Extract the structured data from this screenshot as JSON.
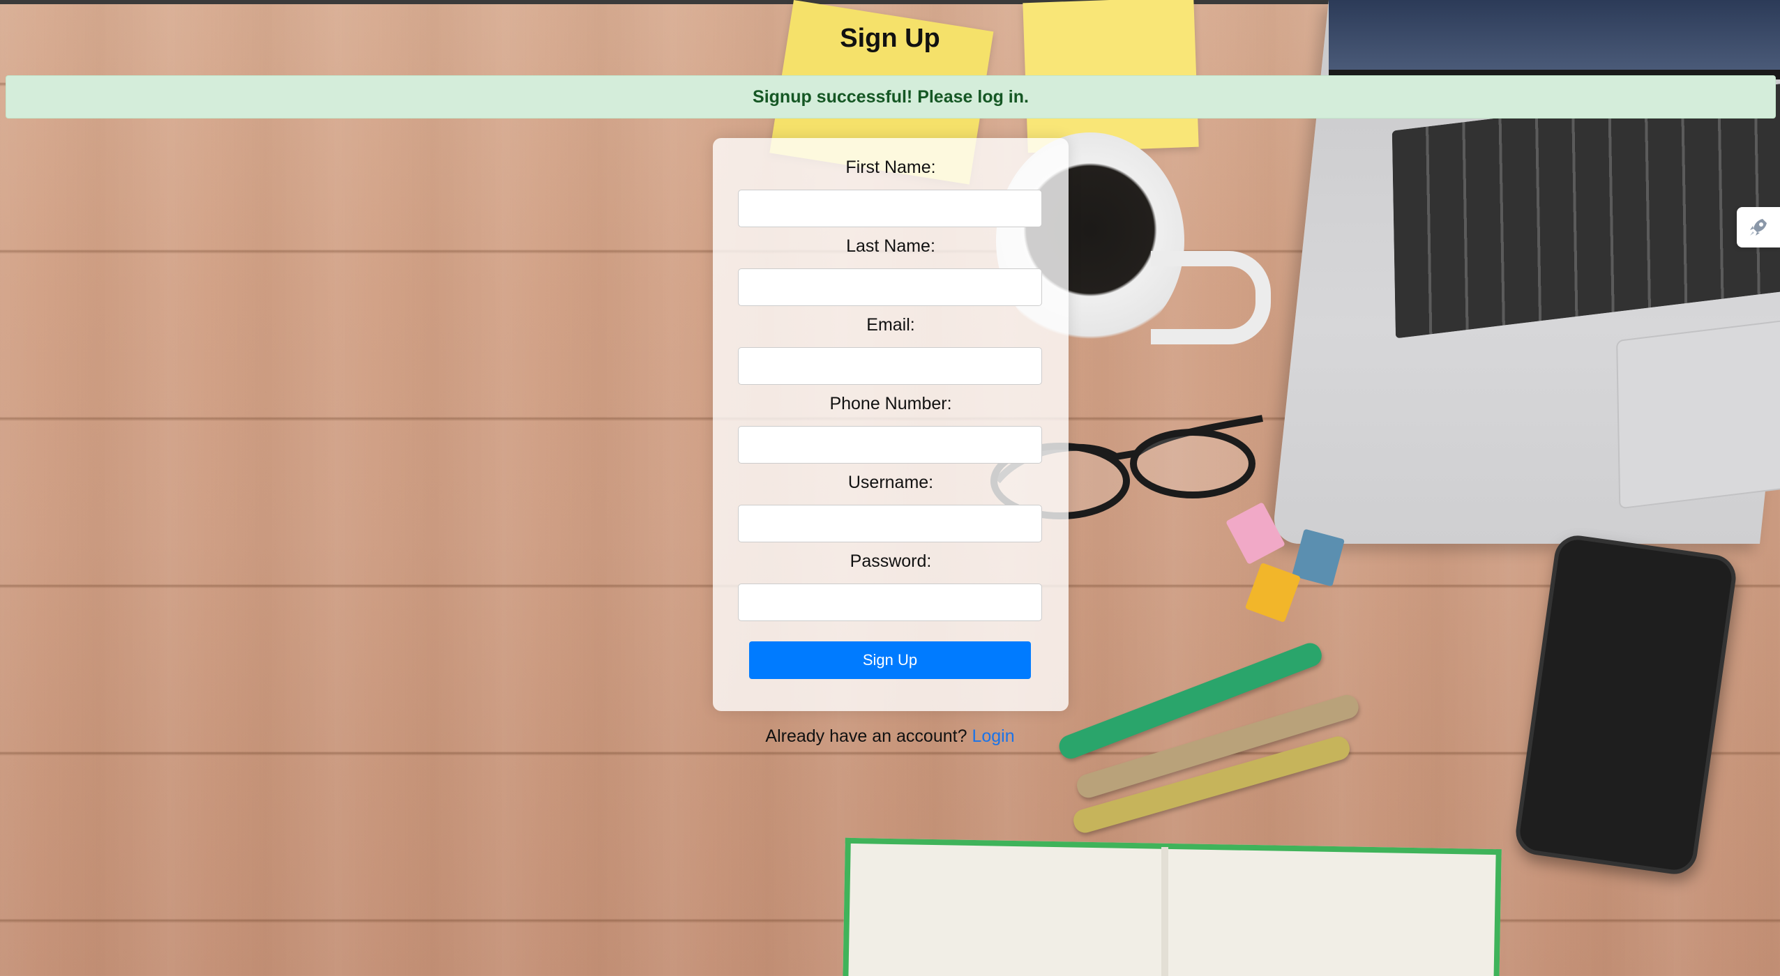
{
  "page": {
    "title": "Sign Up"
  },
  "alert": {
    "message": "Signup successful! Please log in.",
    "color": "#d4edda",
    "text_color": "#155724"
  },
  "form": {
    "fields": [
      {
        "label": "First Name:",
        "value": ""
      },
      {
        "label": "Last Name:",
        "value": ""
      },
      {
        "label": "Email:",
        "value": ""
      },
      {
        "label": "Phone Number:",
        "value": ""
      },
      {
        "label": "Username:",
        "value": ""
      },
      {
        "label": "Password:",
        "value": ""
      }
    ],
    "submit_label": "Sign Up",
    "submit_color": "#007bff"
  },
  "footer": {
    "prompt": "Already have an account?",
    "link_label": "Login"
  },
  "side_tab": {
    "icon": "rocket-icon"
  }
}
